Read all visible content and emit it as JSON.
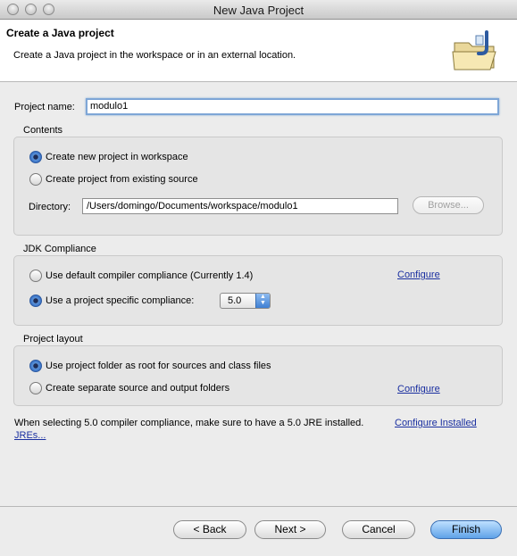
{
  "window": {
    "title": "New Java Project"
  },
  "banner": {
    "title": "Create a Java project",
    "description": "Create a Java project in the workspace or in an external location.",
    "icon": "java-project-folder-icon"
  },
  "project_name": {
    "label": "Project name:",
    "value": "modulo1"
  },
  "contents": {
    "title": "Contents",
    "option_new": "Create new project in workspace",
    "option_existing": "Create project from existing source",
    "selected": "option_new",
    "directory_label": "Directory:",
    "directory_value": "/Users/domingo/Documents/workspace/modulo1",
    "browse_label": "Browse..."
  },
  "jdk": {
    "title": "JDK Compliance",
    "option_default": "Use default compiler compliance (Currently 1.4)",
    "option_specific": "Use a project specific compliance:",
    "selected": "option_specific",
    "compliance_value": "5.0",
    "configure_label": "Configure"
  },
  "layout": {
    "title": "Project layout",
    "option_root": "Use project folder as root for sources and class files",
    "option_separate": "Create separate source and output folders",
    "selected": "option_root",
    "configure_label": "Configure"
  },
  "note": {
    "text": "When selecting 5.0 compiler compliance, make sure to have a 5.0 JRE installed.",
    "link_line1": "Configure Installed",
    "link_line2": "JREs..."
  },
  "buttons": {
    "back": "< Back",
    "next": "Next >",
    "cancel": "Cancel",
    "finish": "Finish"
  },
  "colors": {
    "default_button": "#5fa2e8",
    "link": "#1a2fa0",
    "selected_radio": "#2d67c2"
  }
}
